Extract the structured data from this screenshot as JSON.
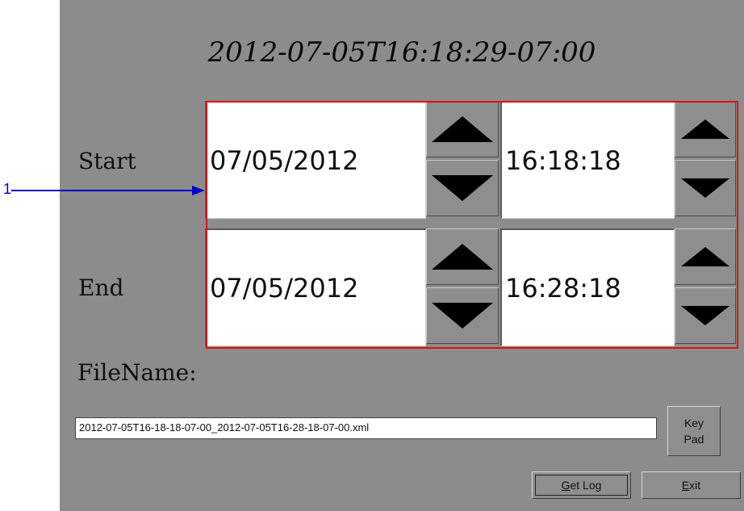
{
  "header": {
    "timestamp": "2012-07-05T16:18:29-07:00"
  },
  "start": {
    "label": "Start",
    "date": "07/05/2012",
    "time": "16:18:18"
  },
  "end": {
    "label": "End",
    "date": "07/05/2012",
    "time": "16:28:18"
  },
  "file": {
    "label": "FileName:",
    "value": "2012-07-05T16-18-18-07-00_2012-07-05T16-28-18-07-00.xml"
  },
  "buttons": {
    "keypad_line1": "Key",
    "keypad_line2": "Pad",
    "getlog_mnemonic": "G",
    "getlog_rest": "et Log",
    "exit_mnemonic": "E",
    "exit_rest": "xit"
  },
  "callout": {
    "number": "1"
  },
  "colors": {
    "panel": "#8c8c8c",
    "highlight_box": "#e01010",
    "callout": "#0000cc"
  },
  "icons": {
    "increment": "triangle-up-icon",
    "decrement": "triangle-down-icon"
  }
}
